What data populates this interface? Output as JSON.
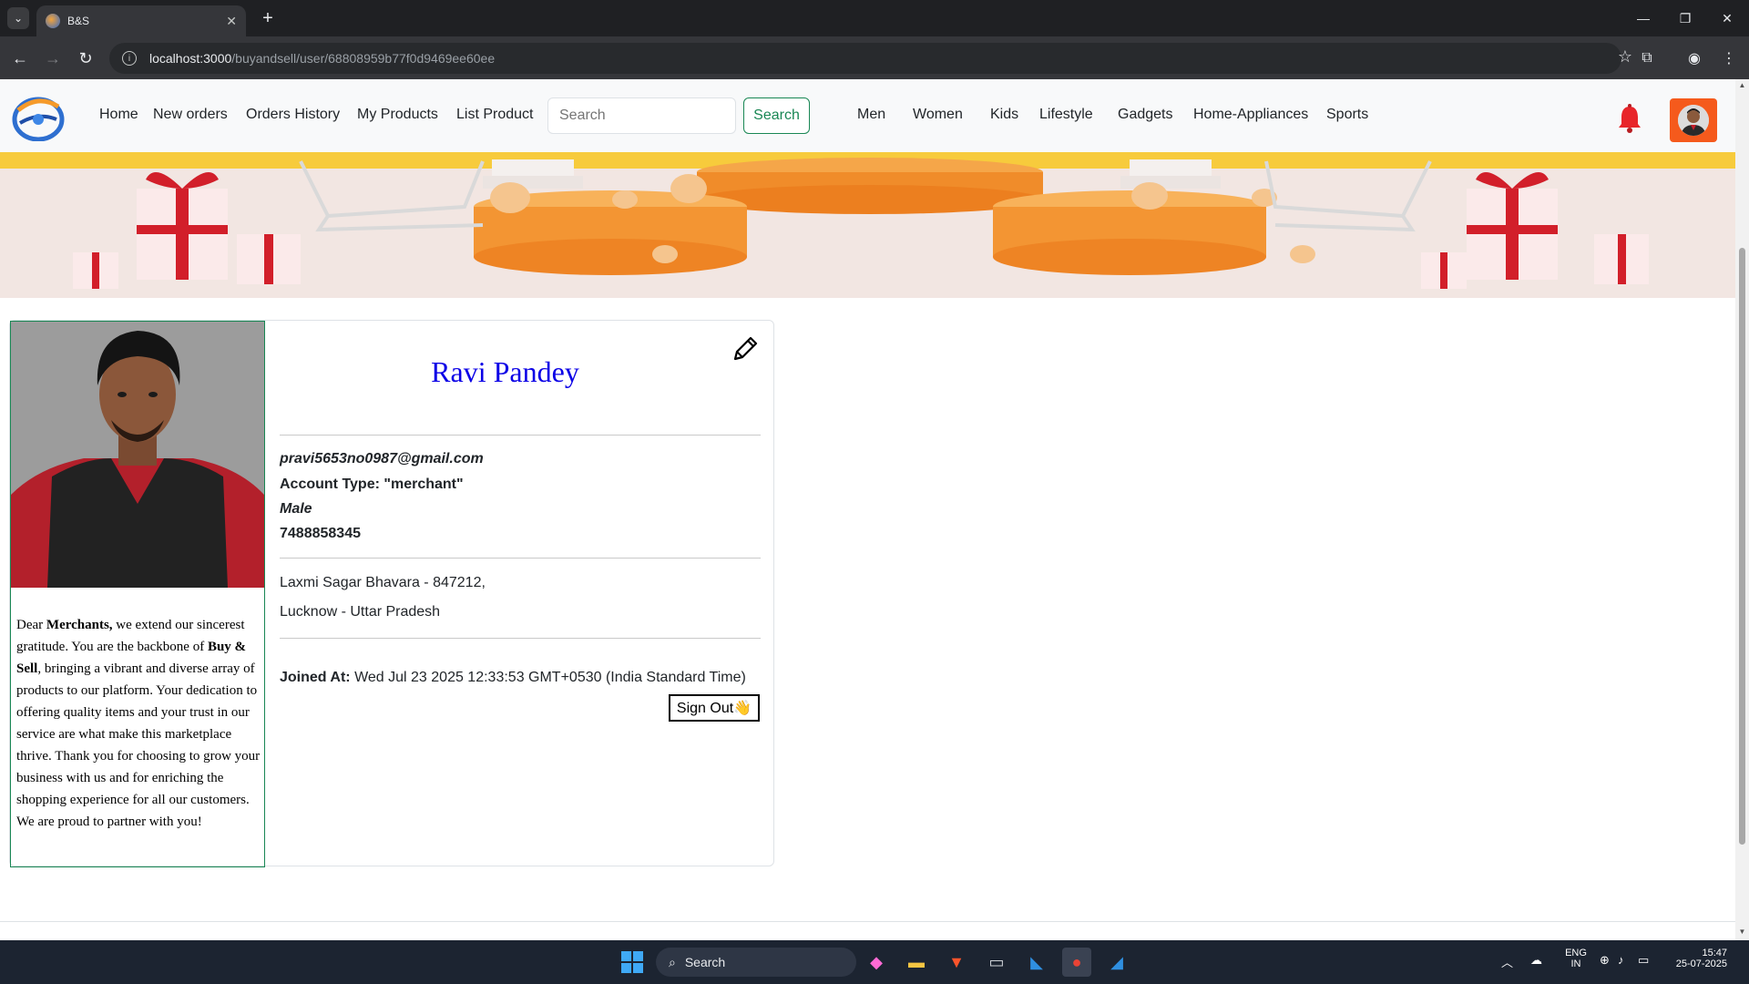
{
  "browser": {
    "tab_title": "B&S",
    "url_host": "localhost:3000",
    "url_path": "/buyandsell/user/68808959b77f0d9469ee60ee"
  },
  "navbar": {
    "links": [
      "Home",
      "New orders",
      "Orders History",
      "My Products",
      "List Product"
    ],
    "search_placeholder": "Search",
    "search_button": "Search",
    "categories": [
      "Men",
      "Women",
      "Kids",
      "Lifestyle",
      "Gadgets",
      "Home-Appliances",
      "Sports"
    ]
  },
  "profile": {
    "name": "Ravi Pandey",
    "email": "pravi5653no0987@gmail.com",
    "account_type": "Account Type: \"merchant\"",
    "gender": "Male",
    "phone": "7488858345",
    "address_line1": "Laxmi Sagar Bhavara - 847212,",
    "address_line2": "Lucknow - Uttar Pradesh",
    "joined_label": "Joined At:",
    "joined_value": " Wed Jul 23 2025 12:33:53 GMT+0530 (India Standard Time)",
    "signout_label": "Sign Out👋"
  },
  "thanks_message": {
    "p1": "Dear ",
    "b1": "Merchants,",
    "p2": " we extend our sincerest gratitude. You are the backbone of ",
    "b2": "Buy & Sell",
    "p3": ", bringing a vibrant and diverse array of products to our platform. Your dedication to offering quality items and your trust in our service are what make this marketplace thrive. Thank you for choosing to grow your business with us and for enriching the shopping experience for all our customers. We are proud to partner with you!"
  },
  "taskbar": {
    "search_label": "Search",
    "lang_top": "ENG",
    "lang_bottom": "IN",
    "time": "15:47",
    "date": "25-07-2025"
  },
  "colors": {
    "name_blue": "#0b00e6",
    "search_green": "#198754",
    "avatar_orange": "#f55a1c"
  }
}
